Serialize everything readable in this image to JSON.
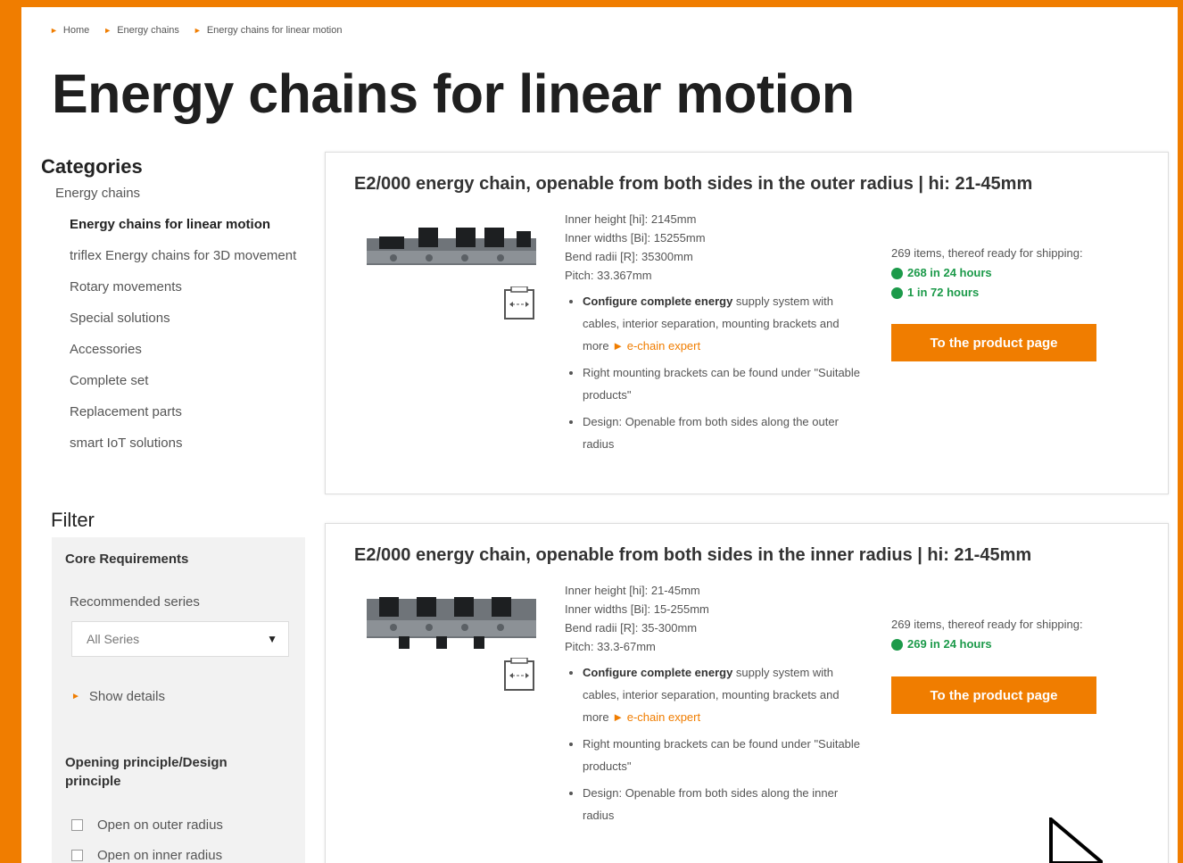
{
  "breadcrumb": [
    "Home",
    "Energy chains",
    "Energy chains for linear motion"
  ],
  "page_title": "Energy chains for linear motion",
  "categories": {
    "title": "Categories",
    "parent": "Energy chains",
    "items": [
      "Energy chains for linear motion",
      "triflex Energy chains for 3D movement",
      "Rotary movements",
      "Special solutions",
      "Accessories",
      "Complete set",
      "Replacement parts",
      "smart IoT solutions"
    ]
  },
  "filter": {
    "title": "Filter",
    "core_requirements": "Core Requirements",
    "recommended_series": "Recommended series",
    "series_select": "All Series",
    "show_details": "Show details",
    "opening_principle": "Opening principle/Design principle",
    "options": [
      "Open on outer radius",
      "Open on inner radius"
    ]
  },
  "products": [
    {
      "title": "E2/000 energy chain, openable from both sides in the outer radius | hi: 21-45mm",
      "specs": [
        "Inner height [hi]: 2145mm",
        "Inner widths [Bi]: 15255mm",
        "Bend radii [R]: 35300mm",
        "Pitch: 33.367mm"
      ],
      "feature1_bold": "Configure complete energy",
      "feature1_rest": " supply system with cables, interior separation, mounting brackets and more ",
      "feature1_link": "► e-chain expert",
      "feature2": "Right mounting brackets can be found under \"Suitable products\"",
      "feature3": "Design: Openable from both sides along the outer radius",
      "stock_text": "269 items, thereof ready for shipping:",
      "stock_rows": [
        "268 in 24 hours",
        "1 in 72 hours"
      ],
      "button": "To the product page"
    },
    {
      "title": "E2/000 energy chain, openable from both sides in the inner radius | hi: 21-45mm",
      "specs": [
        "Inner height [hi]: 21-45mm",
        "Inner widths [Bi]: 15-255mm",
        "Bend radii [R]: 35-300mm",
        "Pitch: 33.3-67mm"
      ],
      "feature1_bold": "Configure complete energy",
      "feature1_rest": " supply system with cables, interior separation, mounting brackets and more ",
      "feature1_link": "► e-chain expert",
      "feature2": "Right mounting brackets can be found under \"Suitable products\"",
      "feature3": "Design: Openable from both sides along the inner radius",
      "stock_text": "269 items, thereof ready for shipping:",
      "stock_rows": [
        "269 in 24 hours"
      ],
      "button": "To the product page"
    }
  ],
  "colors": {
    "brand": "#f07d00",
    "stock_green": "#1c9a4a"
  }
}
